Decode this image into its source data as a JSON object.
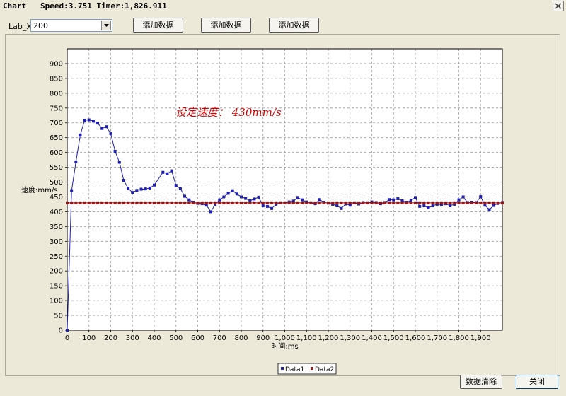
{
  "window": {
    "title": "Chart   Speed:3.751 Timer:1,826.911",
    "close_icon": "close-icon"
  },
  "toolbar": {
    "lab_label": "Lab_X",
    "combo_value": "200",
    "add_buttons": [
      "添加数据",
      "添加数据",
      "添加数据"
    ]
  },
  "footer": {
    "clear_label": "数据清除",
    "close_label": "关闭"
  },
  "chart_data": {
    "type": "line",
    "title": "",
    "annotation": "设定速度： 430mm/s",
    "xlabel": "时间:ms",
    "ylabel": "速度:mm/s",
    "xlim": [
      0,
      2000
    ],
    "ylim": [
      0,
      950
    ],
    "grid": true,
    "legend_position": "bottom-center",
    "x_ticks": [
      "0",
      "100",
      "200",
      "300",
      "400",
      "500",
      "600",
      "700",
      "800",
      "900",
      "1,000",
      "1,100",
      "1,200",
      "1,300",
      "1,400",
      "1,500",
      "1,600",
      "1,700",
      "1,800",
      "1,900"
    ],
    "y_ticks": [
      "0",
      "50",
      "100",
      "150",
      "200",
      "250",
      "300",
      "350",
      "400",
      "450",
      "500",
      "550",
      "600",
      "650",
      "700",
      "750",
      "800",
      "850",
      "900"
    ],
    "colors": {
      "data1": "#1f1fb0",
      "data2": "#c00000",
      "marker_data2": "#8b1a1a",
      "annotation": "#d40000"
    },
    "series": [
      {
        "name": "Data1",
        "x": [
          0,
          20,
          40,
          60,
          80,
          100,
          120,
          140,
          160,
          180,
          200,
          220,
          240,
          260,
          280,
          300,
          320,
          340,
          360,
          380,
          400,
          440,
          460,
          480,
          500,
          520,
          540,
          560,
          580,
          600,
          620,
          640,
          660,
          680,
          700,
          720,
          740,
          760,
          780,
          800,
          820,
          840,
          860,
          880,
          900,
          920,
          940,
          960,
          980,
          1000,
          1020,
          1040,
          1060,
          1080,
          1100,
          1120,
          1140,
          1160,
          1180,
          1200,
          1220,
          1240,
          1260,
          1280,
          1300,
          1320,
          1340,
          1360,
          1380,
          1400,
          1420,
          1440,
          1460,
          1480,
          1500,
          1520,
          1540,
          1560,
          1580,
          1600,
          1620,
          1640,
          1660,
          1680,
          1700,
          1720,
          1740,
          1760,
          1780,
          1800,
          1820,
          1840,
          1860,
          1880,
          1900,
          1920,
          1940,
          1960,
          1980,
          2000
        ],
        "values": [
          0,
          471,
          568,
          659,
          709,
          710,
          706,
          699,
          681,
          687,
          664,
          604,
          567,
          506,
          479,
          465,
          472,
          476,
          477,
          480,
          490,
          533,
          528,
          538,
          489,
          478,
          452,
          440,
          432,
          428,
          427,
          422,
          400,
          425,
          440,
          450,
          462,
          471,
          460,
          450,
          445,
          437,
          443,
          449,
          420,
          418,
          411,
          425,
          430,
          430,
          433,
          436,
          448,
          440,
          433,
          430,
          427,
          441,
          432,
          429,
          425,
          420,
          411,
          426,
          422,
          430,
          426,
          431,
          430,
          433,
          431,
          427,
          431,
          441,
          440,
          444,
          437,
          432,
          438,
          448,
          418,
          420,
          413,
          420,
          425,
          424,
          427,
          420,
          425,
          440,
          450,
          431,
          432,
          431,
          451,
          422,
          407,
          421,
          428,
          431
        ]
      },
      {
        "name": "Data2",
        "x": [
          0,
          20,
          40,
          60,
          80,
          100,
          120,
          140,
          160,
          180,
          200,
          220,
          240,
          260,
          280,
          300,
          320,
          340,
          360,
          380,
          400,
          420,
          440,
          460,
          480,
          500,
          520,
          540,
          560,
          580,
          600,
          620,
          640,
          660,
          680,
          700,
          720,
          740,
          760,
          780,
          800,
          820,
          840,
          860,
          880,
          900,
          920,
          940,
          960,
          980,
          1000,
          1020,
          1040,
          1060,
          1080,
          1100,
          1120,
          1140,
          1160,
          1180,
          1200,
          1220,
          1240,
          1260,
          1280,
          1300,
          1320,
          1340,
          1360,
          1380,
          1400,
          1420,
          1440,
          1460,
          1480,
          1500,
          1520,
          1540,
          1560,
          1580,
          1600,
          1620,
          1640,
          1660,
          1680,
          1700,
          1720,
          1740,
          1760,
          1780,
          1800,
          1820,
          1840,
          1860,
          1880,
          1900,
          1920,
          1940,
          1960,
          1980,
          2000
        ],
        "values": [
          430,
          430,
          430,
          430,
          430,
          430,
          430,
          430,
          430,
          430,
          430,
          430,
          430,
          430,
          430,
          430,
          430,
          430,
          430,
          430,
          430,
          430,
          430,
          430,
          430,
          430,
          430,
          430,
          430,
          430,
          430,
          430,
          430,
          430,
          430,
          430,
          430,
          430,
          430,
          430,
          430,
          430,
          430,
          430,
          430,
          430,
          430,
          430,
          430,
          430,
          430,
          430,
          430,
          430,
          430,
          430,
          430,
          430,
          430,
          430,
          430,
          430,
          430,
          430,
          430,
          430,
          430,
          430,
          430,
          430,
          430,
          430,
          430,
          430,
          430,
          430,
          430,
          430,
          430,
          430,
          430,
          430,
          430,
          430,
          430,
          430,
          430,
          430,
          430,
          430,
          430,
          430,
          430,
          430,
          430,
          430,
          430,
          430,
          430,
          430,
          430
        ]
      }
    ]
  }
}
